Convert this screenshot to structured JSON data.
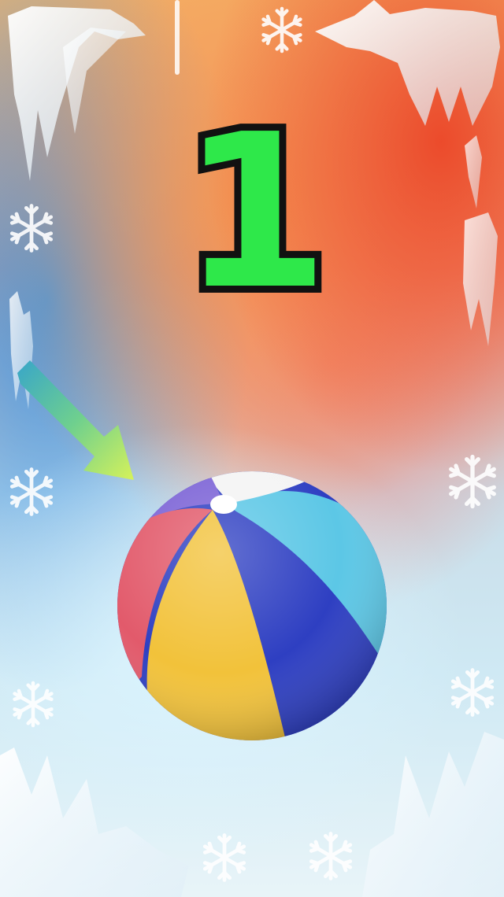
{
  "counter": {
    "value": "1"
  },
  "colors": {
    "counter_fill": "#2ee84a",
    "counter_outline": "#111111",
    "ball_white": "#f4f4f4",
    "ball_purple": "#7b62d6",
    "ball_red": "#e25a6b",
    "ball_yellow": "#f2c23a",
    "ball_blue": "#2e3fc2",
    "ball_cyan": "#5cc7e6",
    "arrow_start": "#3aa7c7",
    "arrow_end": "#d6f25a"
  },
  "decorations": [
    "ice-crystal-icon",
    "snowflake-icon",
    "arrow-icon",
    "beach-ball"
  ]
}
